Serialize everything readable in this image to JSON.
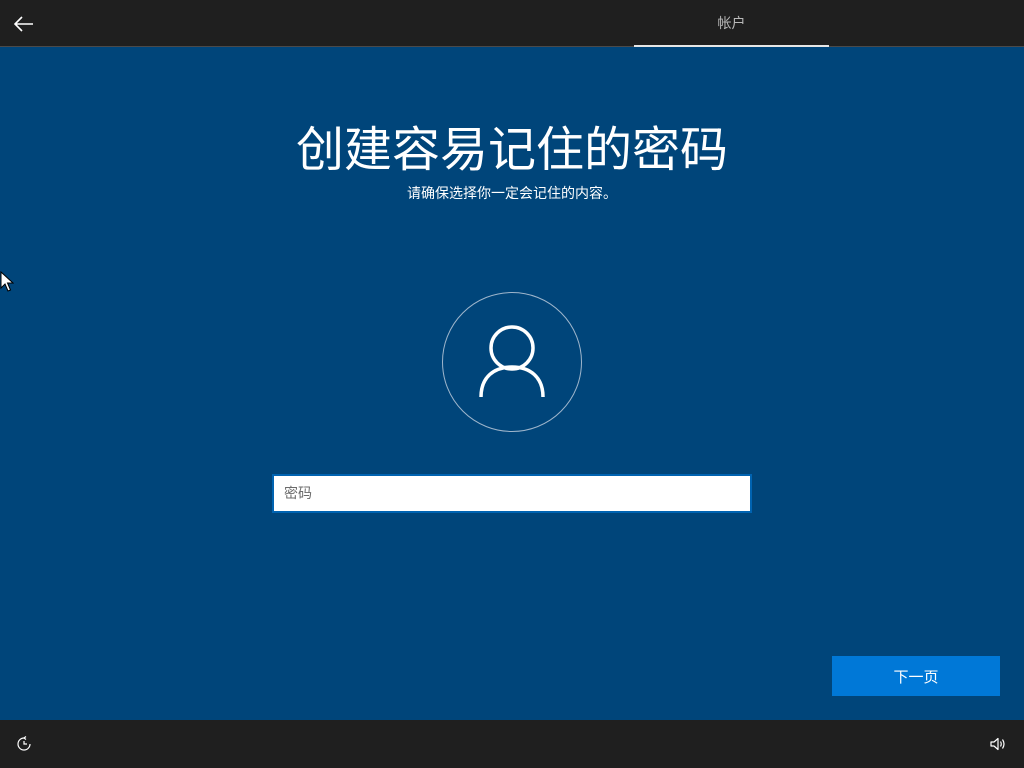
{
  "top_bar": {
    "back_icon": "arrow-left-icon",
    "step_label": "帐户"
  },
  "main": {
    "title": "创建容易记住的密码",
    "subtitle": "请确保选择你一定会记住的内容。",
    "avatar_icon": "user-icon",
    "password": {
      "value": "",
      "placeholder": "密码"
    },
    "next_label": "下一页"
  },
  "bottom_bar": {
    "accessibility_icon": "ease-of-access-icon",
    "volume_icon": "volume-icon"
  },
  "colors": {
    "background": "#00457a",
    "bar": "#1f1f1f",
    "accent": "#0078d7"
  }
}
